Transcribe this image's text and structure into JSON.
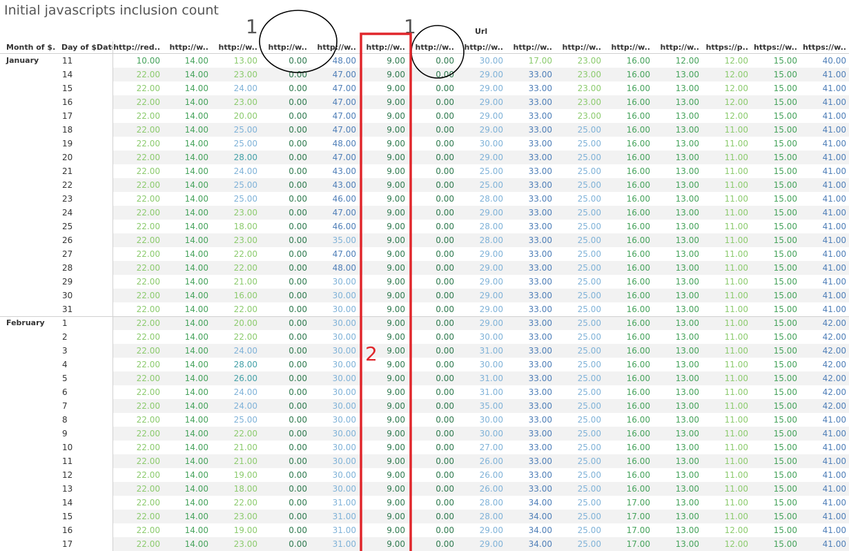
{
  "title": "Initial javascripts inclusion count",
  "column_group_label": "Url",
  "row_headers": [
    "Month of $..",
    "Day of $Date"
  ],
  "url_headers": [
    "http://red..",
    "http://w..",
    "http://w..",
    "http://w..",
    "http://w..",
    "http://w..",
    "http://w..",
    "http://w..",
    "http://w..",
    "http://w..",
    "http://w..",
    "http://w..",
    "https://p..",
    "https://w..",
    "https://w.."
  ],
  "colors": {
    "light_green": "#8ccb6e",
    "mid_green": "#46a35c",
    "dark_green": "#2f7a4f",
    "teal": "#43a0a7",
    "light_blue": "#7fb2d8",
    "blue": "#4f7fb8",
    "annotation_black": "#000000",
    "annotation_red": "#e0262b"
  },
  "annotations": {
    "label_1a": "1",
    "label_1b": "1",
    "label_2": "2"
  },
  "months": [
    {
      "name": "January",
      "rows": [
        {
          "day": "11",
          "values": [
            "10.00",
            "14.00",
            "13.00",
            "0.00",
            "48.00",
            "9.00",
            "0.00",
            "30.00",
            "17.00",
            "23.00",
            "16.00",
            "12.00",
            "12.00",
            "15.00",
            "40.00"
          ]
        },
        {
          "day": "14",
          "values": [
            "22.00",
            "14.00",
            "23.00",
            "0.00",
            "47.00",
            "9.00",
            "0.00",
            "29.00",
            "33.00",
            "23.00",
            "16.00",
            "13.00",
            "12.00",
            "15.00",
            "41.00"
          ]
        },
        {
          "day": "15",
          "values": [
            "22.00",
            "14.00",
            "24.00",
            "0.00",
            "47.00",
            "9.00",
            "0.00",
            "29.00",
            "33.00",
            "23.00",
            "16.00",
            "13.00",
            "12.00",
            "15.00",
            "41.00"
          ]
        },
        {
          "day": "16",
          "values": [
            "22.00",
            "14.00",
            "23.00",
            "0.00",
            "47.00",
            "9.00",
            "0.00",
            "29.00",
            "33.00",
            "23.00",
            "16.00",
            "13.00",
            "12.00",
            "15.00",
            "41.00"
          ]
        },
        {
          "day": "17",
          "values": [
            "22.00",
            "14.00",
            "20.00",
            "0.00",
            "47.00",
            "9.00",
            "0.00",
            "29.00",
            "33.00",
            "23.00",
            "16.00",
            "13.00",
            "12.00",
            "15.00",
            "41.00"
          ]
        },
        {
          "day": "18",
          "values": [
            "22.00",
            "14.00",
            "25.00",
            "0.00",
            "47.00",
            "9.00",
            "0.00",
            "29.00",
            "33.00",
            "25.00",
            "16.00",
            "13.00",
            "11.00",
            "15.00",
            "41.00"
          ]
        },
        {
          "day": "19",
          "values": [
            "22.00",
            "14.00",
            "25.00",
            "0.00",
            "48.00",
            "9.00",
            "0.00",
            "30.00",
            "33.00",
            "25.00",
            "16.00",
            "13.00",
            "11.00",
            "15.00",
            "41.00"
          ]
        },
        {
          "day": "20",
          "values": [
            "22.00",
            "14.00",
            "28.00",
            "0.00",
            "47.00",
            "9.00",
            "0.00",
            "29.00",
            "33.00",
            "25.00",
            "16.00",
            "13.00",
            "11.00",
            "15.00",
            "41.00"
          ]
        },
        {
          "day": "21",
          "values": [
            "22.00",
            "14.00",
            "24.00",
            "0.00",
            "43.00",
            "9.00",
            "0.00",
            "25.00",
            "33.00",
            "25.00",
            "16.00",
            "13.00",
            "11.00",
            "15.00",
            "41.00"
          ]
        },
        {
          "day": "22",
          "values": [
            "22.00",
            "14.00",
            "25.00",
            "0.00",
            "43.00",
            "9.00",
            "0.00",
            "25.00",
            "33.00",
            "25.00",
            "16.00",
            "13.00",
            "11.00",
            "15.00",
            "41.00"
          ]
        },
        {
          "day": "23",
          "values": [
            "22.00",
            "14.00",
            "25.00",
            "0.00",
            "46.00",
            "9.00",
            "0.00",
            "28.00",
            "33.00",
            "25.00",
            "16.00",
            "13.00",
            "11.00",
            "15.00",
            "41.00"
          ]
        },
        {
          "day": "24",
          "values": [
            "22.00",
            "14.00",
            "23.00",
            "0.00",
            "47.00",
            "9.00",
            "0.00",
            "29.00",
            "33.00",
            "25.00",
            "16.00",
            "13.00",
            "11.00",
            "15.00",
            "41.00"
          ]
        },
        {
          "day": "25",
          "values": [
            "22.00",
            "14.00",
            "18.00",
            "0.00",
            "46.00",
            "9.00",
            "0.00",
            "28.00",
            "33.00",
            "25.00",
            "16.00",
            "13.00",
            "11.00",
            "15.00",
            "41.00"
          ]
        },
        {
          "day": "26",
          "values": [
            "22.00",
            "14.00",
            "23.00",
            "0.00",
            "35.00",
            "9.00",
            "0.00",
            "28.00",
            "33.00",
            "25.00",
            "16.00",
            "13.00",
            "11.00",
            "15.00",
            "41.00"
          ]
        },
        {
          "day": "27",
          "values": [
            "22.00",
            "14.00",
            "22.00",
            "0.00",
            "47.00",
            "9.00",
            "0.00",
            "29.00",
            "33.00",
            "25.00",
            "16.00",
            "13.00",
            "11.00",
            "15.00",
            "41.00"
          ]
        },
        {
          "day": "28",
          "values": [
            "22.00",
            "14.00",
            "22.00",
            "0.00",
            "48.00",
            "9.00",
            "0.00",
            "29.00",
            "33.00",
            "25.00",
            "16.00",
            "13.00",
            "11.00",
            "15.00",
            "41.00"
          ]
        },
        {
          "day": "29",
          "values": [
            "22.00",
            "14.00",
            "21.00",
            "0.00",
            "30.00",
            "9.00",
            "0.00",
            "29.00",
            "33.00",
            "25.00",
            "16.00",
            "13.00",
            "11.00",
            "15.00",
            "41.00"
          ]
        },
        {
          "day": "30",
          "values": [
            "22.00",
            "14.00",
            "16.00",
            "0.00",
            "30.00",
            "9.00",
            "0.00",
            "29.00",
            "33.00",
            "25.00",
            "16.00",
            "13.00",
            "11.00",
            "15.00",
            "41.00"
          ]
        },
        {
          "day": "31",
          "values": [
            "22.00",
            "14.00",
            "22.00",
            "0.00",
            "30.00",
            "9.00",
            "0.00",
            "29.00",
            "33.00",
            "25.00",
            "16.00",
            "13.00",
            "11.00",
            "15.00",
            "41.00"
          ]
        }
      ]
    },
    {
      "name": "February",
      "rows": [
        {
          "day": "1",
          "values": [
            "22.00",
            "14.00",
            "20.00",
            "0.00",
            "30.00",
            "9.00",
            "0.00",
            "29.00",
            "33.00",
            "25.00",
            "16.00",
            "13.00",
            "11.00",
            "15.00",
            "42.00"
          ]
        },
        {
          "day": "2",
          "values": [
            "22.00",
            "14.00",
            "22.00",
            "0.00",
            "30.00",
            "9.00",
            "0.00",
            "30.00",
            "33.00",
            "25.00",
            "16.00",
            "13.00",
            "11.00",
            "15.00",
            "42.00"
          ]
        },
        {
          "day": "3",
          "values": [
            "22.00",
            "14.00",
            "24.00",
            "0.00",
            "30.00",
            "9.00",
            "0.00",
            "31.00",
            "33.00",
            "25.00",
            "16.00",
            "13.00",
            "11.00",
            "15.00",
            "42.00"
          ]
        },
        {
          "day": "4",
          "values": [
            "22.00",
            "14.00",
            "28.00",
            "0.00",
            "30.00",
            "9.00",
            "0.00",
            "30.00",
            "33.00",
            "25.00",
            "16.00",
            "13.00",
            "11.00",
            "15.00",
            "42.00"
          ]
        },
        {
          "day": "5",
          "values": [
            "22.00",
            "14.00",
            "26.00",
            "0.00",
            "30.00",
            "9.00",
            "0.00",
            "31.00",
            "33.00",
            "25.00",
            "16.00",
            "13.00",
            "11.00",
            "15.00",
            "42.00"
          ]
        },
        {
          "day": "6",
          "values": [
            "22.00",
            "14.00",
            "24.00",
            "0.00",
            "30.00",
            "9.00",
            "0.00",
            "31.00",
            "33.00",
            "25.00",
            "16.00",
            "13.00",
            "11.00",
            "15.00",
            "42.00"
          ]
        },
        {
          "day": "7",
          "values": [
            "22.00",
            "14.00",
            "24.00",
            "0.00",
            "30.00",
            "9.00",
            "0.00",
            "35.00",
            "33.00",
            "25.00",
            "16.00",
            "13.00",
            "11.00",
            "15.00",
            "42.00"
          ]
        },
        {
          "day": "8",
          "values": [
            "22.00",
            "14.00",
            "25.00",
            "0.00",
            "30.00",
            "9.00",
            "0.00",
            "30.00",
            "33.00",
            "25.00",
            "16.00",
            "13.00",
            "11.00",
            "15.00",
            "41.00"
          ]
        },
        {
          "day": "9",
          "values": [
            "22.00",
            "14.00",
            "22.00",
            "0.00",
            "30.00",
            "9.00",
            "0.00",
            "30.00",
            "33.00",
            "25.00",
            "16.00",
            "13.00",
            "11.00",
            "15.00",
            "41.00"
          ]
        },
        {
          "day": "10",
          "values": [
            "22.00",
            "14.00",
            "21.00",
            "0.00",
            "30.00",
            "9.00",
            "0.00",
            "27.00",
            "33.00",
            "25.00",
            "16.00",
            "13.00",
            "11.00",
            "15.00",
            "41.00"
          ]
        },
        {
          "day": "11",
          "values": [
            "22.00",
            "14.00",
            "21.00",
            "0.00",
            "30.00",
            "9.00",
            "0.00",
            "26.00",
            "33.00",
            "25.00",
            "16.00",
            "13.00",
            "11.00",
            "15.00",
            "41.00"
          ]
        },
        {
          "day": "12",
          "values": [
            "22.00",
            "14.00",
            "19.00",
            "0.00",
            "30.00",
            "9.00",
            "0.00",
            "26.00",
            "33.00",
            "25.00",
            "16.00",
            "13.00",
            "11.00",
            "15.00",
            "41.00"
          ]
        },
        {
          "day": "13",
          "values": [
            "22.00",
            "14.00",
            "18.00",
            "0.00",
            "30.00",
            "9.00",
            "0.00",
            "26.00",
            "33.00",
            "25.00",
            "16.00",
            "13.00",
            "11.00",
            "15.00",
            "41.00"
          ]
        },
        {
          "day": "14",
          "values": [
            "22.00",
            "14.00",
            "22.00",
            "0.00",
            "31.00",
            "9.00",
            "0.00",
            "28.00",
            "34.00",
            "25.00",
            "17.00",
            "13.00",
            "11.00",
            "15.00",
            "41.00"
          ]
        },
        {
          "day": "15",
          "values": [
            "22.00",
            "14.00",
            "23.00",
            "0.00",
            "31.00",
            "9.00",
            "0.00",
            "28.00",
            "34.00",
            "25.00",
            "17.00",
            "13.00",
            "11.00",
            "15.00",
            "41.00"
          ]
        },
        {
          "day": "16",
          "values": [
            "22.00",
            "14.00",
            "19.00",
            "0.00",
            "31.00",
            "9.00",
            "0.00",
            "29.00",
            "34.00",
            "25.00",
            "17.00",
            "13.00",
            "12.00",
            "15.00",
            "41.00"
          ]
        },
        {
          "day": "17",
          "values": [
            "22.00",
            "14.00",
            "23.00",
            "0.00",
            "31.00",
            "9.00",
            "0.00",
            "29.00",
            "34.00",
            "25.00",
            "17.00",
            "13.00",
            "12.00",
            "15.00",
            "41.00"
          ]
        }
      ]
    }
  ]
}
